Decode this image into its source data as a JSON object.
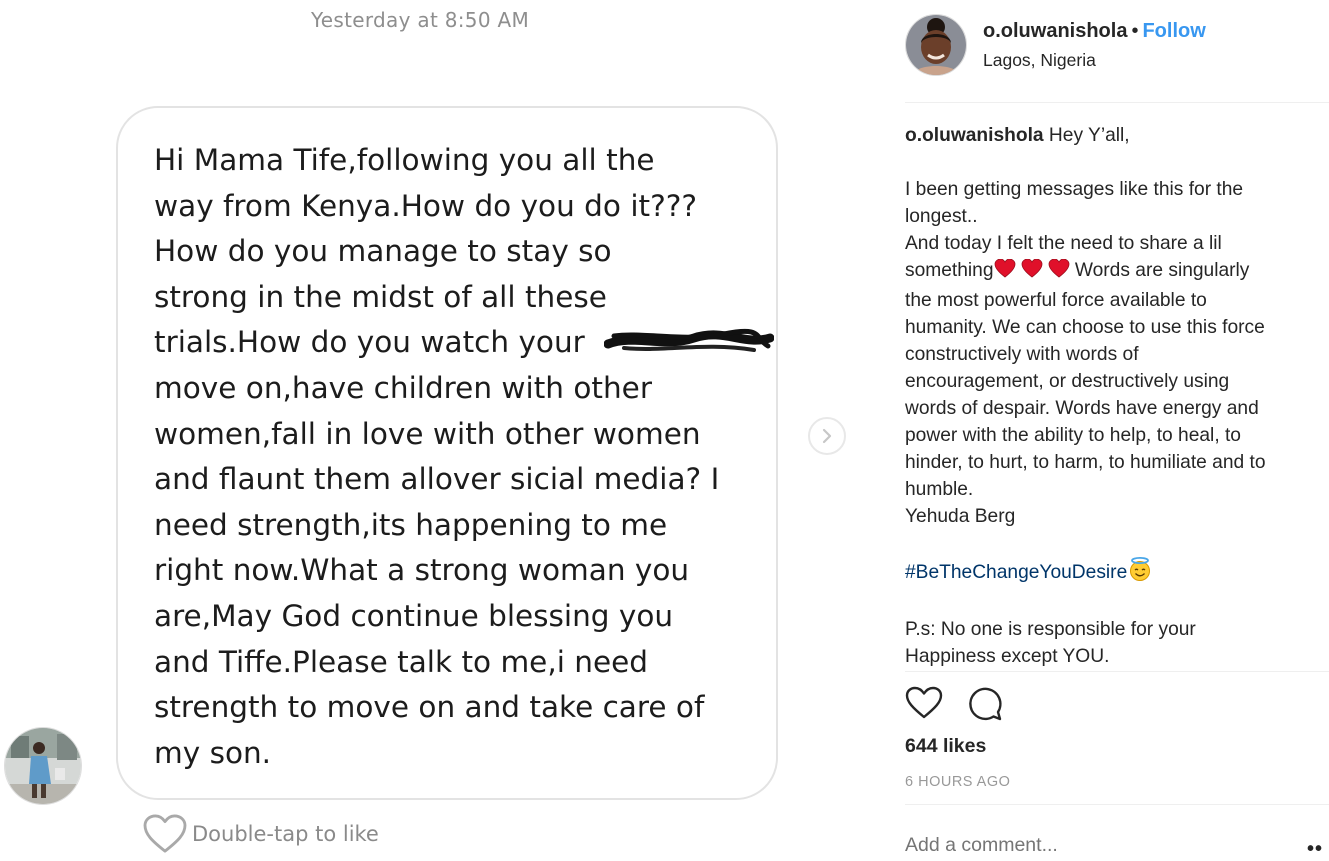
{
  "dm": {
    "timestamp": "Yesterday at 8:50 AM",
    "message": "Hi Mama Tife,following you all the\nway from Kenya.How do you do it???\nHow do you manage to stay so\nstrong in the midst of all these\ntrials.How do you watch your\nmove on,have children with other\nwomen,fall in love with other women\nand flaunt them allover sicial media? I\nneed strength,its happening to me\nright now.What a strong woman you\nare,May God continue blessing you\nand Tiffe.Please talk to me,i need\nstrength to move on and take care of\nmy son.",
    "double_tap_label": "Double-tap to like"
  },
  "post": {
    "username": "o.oluwanishola",
    "separator": "•",
    "follow_label": "Follow",
    "location": "Lagos, Nigeria",
    "caption": {
      "username": "o.oluwanishola",
      "intro": " Hey Y’all,\n\nI been getting messages like this for the\nlongest..\nAnd today I felt the need to share a lil\nsomething",
      "hearts_emoji": "❤️❤️❤️",
      "body": " Words are singularly\nthe most powerful force available to\nhumanity. We can choose to use this force\nconstructively with words of\nencouragement, or destructively using\nwords of despair. Words have energy and\npower with the ability to help, to heal, to\nhinder, to hurt, to harm, to humiliate and to\nhumble.\nYehuda Berg\n\n",
      "hashtag": "#BeTheChangeYouDesire",
      "angel_emoji": "😇",
      "ps": "\n\nP.s: No one is responsible for your\nHappiness except YOU."
    },
    "likes": "644 likes",
    "time_ago": "6 HOURS AGO",
    "comment_placeholder": "Add a comment...",
    "more_label": "••"
  },
  "icons": {
    "heart": "heart-icon",
    "comment": "comment-icon",
    "next": "chevron-right-icon"
  },
  "colors": {
    "follow": "#3897f0",
    "hashtag": "#003569",
    "heart": "#e0102a"
  }
}
